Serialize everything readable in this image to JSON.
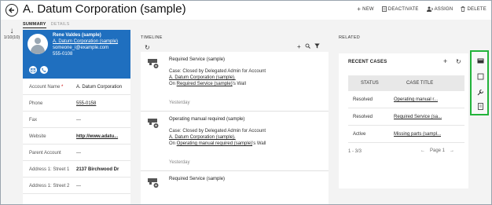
{
  "header": {
    "title": "A. Datum Corporation (sample)",
    "commands": [
      {
        "label": "NEW",
        "icon": "plus-icon"
      },
      {
        "label": "DEACTIVATE",
        "icon": "deactivate-icon"
      },
      {
        "label": "ASSIGN",
        "icon": "assign-icon"
      },
      {
        "label": "DELETE",
        "icon": "trash-icon"
      }
    ]
  },
  "tabs": {
    "summary": "SUMMARY",
    "details": "DETAILS"
  },
  "record_nav": {
    "position": "1/10(10)"
  },
  "contact_card": {
    "name": "Rene Valdes (sample)",
    "company": "A. Datum Corporation (sample)",
    "email": "someone_i@example.com",
    "phone": "555-0108"
  },
  "fields": [
    {
      "label": "Account Name",
      "required": "*",
      "value": "A. Datum Corporation"
    },
    {
      "label": "Phone",
      "required": "",
      "value": "555-0158"
    },
    {
      "label": "Fax",
      "required": "",
      "value": "---"
    },
    {
      "label": "Website",
      "required": "",
      "value": "http://www.adatu..."
    },
    {
      "label": "Parent Account",
      "required": "",
      "value": "---"
    },
    {
      "label": "Address 1: Street 1",
      "required": "",
      "value": "2137 Birchwood Dr"
    },
    {
      "label": "Address 1: Street 2",
      "required": "",
      "value": "---"
    }
  ],
  "timeline": {
    "heading": "TIMELINE",
    "posts": [
      {
        "title": "Required Service (sample)",
        "line1": "Case: Closed by Delegated Admin for Account",
        "link1": "A. Datum Corporation (sample).",
        "prefix2": "On ",
        "link2": "Required Service (sample)",
        "suffix2": "'s Wall",
        "time": "Yesterday"
      },
      {
        "title": "Operating manual required (sample)",
        "line1": "Case: Closed by Delegated Admin for Account",
        "link1": "A. Datum Corporation (sample).",
        "prefix2": "On ",
        "link2": "Operating manual required (sample)",
        "suffix2": "'s Wall",
        "time": "Yesterday"
      },
      {
        "title": "Required Service (sample)"
      }
    ]
  },
  "related": {
    "heading": "RELATED",
    "recent_cases": {
      "title": "RECENT CASES",
      "columns": [
        "STATUS",
        "CASE TITLE"
      ],
      "rows": [
        {
          "status": "Resolved",
          "title": "Operating manual r..."
        },
        {
          "status": "Resolved",
          "title": "Required Service (sa..."
        },
        {
          "status": "Active",
          "title": "Missing parts (sampl..."
        }
      ],
      "count": "1 - 3/3",
      "page_label": "Page 1"
    }
  },
  "side_nav": {
    "icons": [
      "cases-icon",
      "document-icon",
      "wrench-icon",
      "report-icon"
    ],
    "highlight_color": "#22b33a"
  },
  "colors": {
    "card_blue": "#1f6fbf",
    "required_red": "#c00000"
  }
}
